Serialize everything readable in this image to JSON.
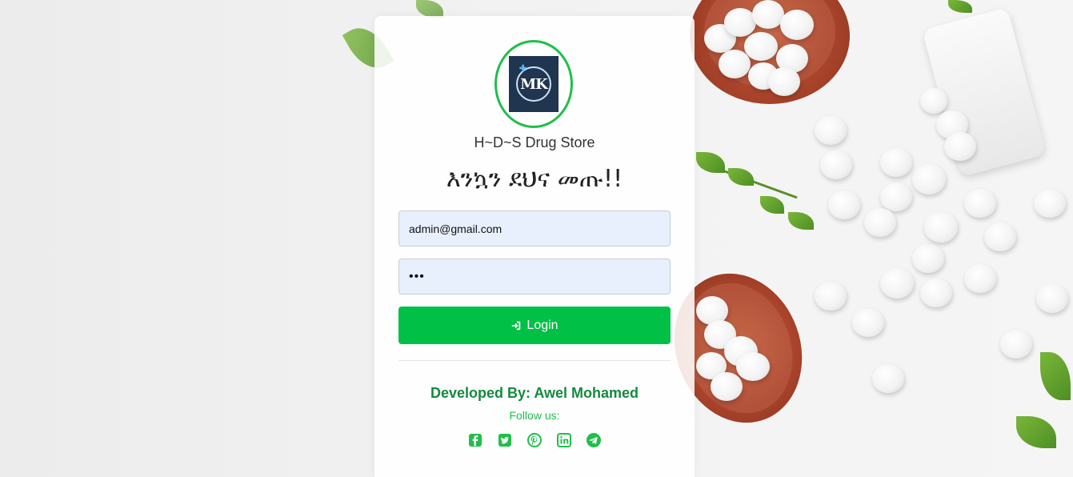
{
  "app": {
    "store_name": "H~D~S Drug Store",
    "welcome_text": "እንኳን ደህና መጡ!!",
    "logo_letters": "MK"
  },
  "form": {
    "email_value": "admin@gmail.com",
    "password_value": "•••",
    "login_label": "Login"
  },
  "footer": {
    "developer": "Developed By: Awel Mohamed",
    "follow_label": "Follow us:",
    "socials": [
      "facebook-icon",
      "twitter-icon",
      "pinterest-icon",
      "linkedin-icon",
      "telegram-icon"
    ]
  },
  "colors": {
    "accent": "#00c046",
    "logo_ring": "#1fbf4a",
    "developer_text": "#138a3e",
    "input_bg": "#e8f0fe"
  }
}
